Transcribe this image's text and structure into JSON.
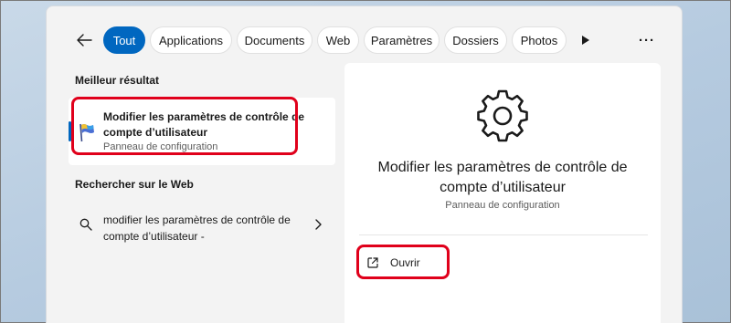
{
  "filters": {
    "tabs": [
      {
        "label": "Tout",
        "active": true
      },
      {
        "label": "Applications"
      },
      {
        "label": "Documents"
      },
      {
        "label": "Web"
      },
      {
        "label": "Paramètres"
      },
      {
        "label": "Dossiers"
      },
      {
        "label": "Photos"
      }
    ],
    "icons": {
      "back": "back-arrow-icon",
      "play": "play-icon",
      "more": "more-icon"
    },
    "more_label": "···"
  },
  "best_match": {
    "heading": "Meilleur résultat",
    "title": "Modifier les paramètres de contrôle de compte d’utilisateur",
    "subtitle": "Panneau de configuration",
    "icon": "uac-flag-icon"
  },
  "web_search": {
    "heading": "Rechercher sur le Web",
    "query": "modifier les paramètres de contrôle de compte d’utilisateur -",
    "icons": {
      "search": "search-icon",
      "chevron": "chevron-right-icon"
    }
  },
  "detail": {
    "icon": "gear-icon",
    "title": "Modifier les paramètres de contrôle de compte d’utilisateur",
    "subtitle": "Panneau de configuration",
    "actions": [
      {
        "label": "Ouvrir",
        "icon": "open-external-icon"
      }
    ]
  },
  "colors": {
    "accent": "#0067c0",
    "highlight": "#e0001b"
  }
}
